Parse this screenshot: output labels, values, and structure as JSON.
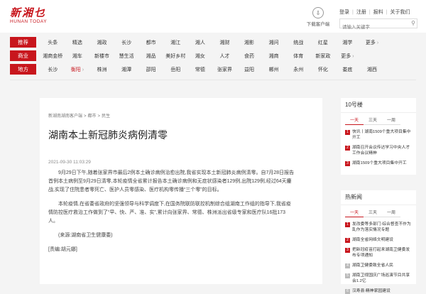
{
  "header": {
    "logo_cn": "新湘乜",
    "logo_en": "HUNAN TODAY",
    "app_label": "下载客户端",
    "links": [
      "登录",
      "注册",
      "报料",
      "关于我们"
    ],
    "search_placeholder": "请输入关键字"
  },
  "nav": [
    {
      "head": "推荐",
      "items": [
        "头条",
        "精选",
        "湘政",
        "长沙",
        "都市",
        "湘江",
        "湘人",
        "湘财",
        "湘影",
        "湘问",
        "统战",
        "红星",
        "湘学",
        "更多"
      ]
    },
    {
      "head": "商业",
      "items": [
        "湘商金桥",
        "湘车",
        "新楼市",
        "慧生活",
        "湘品",
        "美好乡村",
        "湘女",
        "人才",
        "食药",
        "湘商",
        "体育",
        "新家政",
        "更多"
      ]
    },
    {
      "head": "地方",
      "items": [
        "长沙",
        "衡阳",
        "株洲",
        "湘潭",
        "邵阳",
        "岳阳",
        "常德",
        "张家界",
        "益阳",
        "郴州",
        "永州",
        "怀化",
        "娄底",
        "湘西"
      ]
    }
  ],
  "article": {
    "breadcrumb": [
      "新湖南湖南客户端",
      "都市",
      "民生"
    ],
    "title": "湖南本土新冠肺炎病例清零",
    "date": "2021-09-30 11:03:29",
    "paragraphs": [
      "9月29日下午,随着张家界市最后2例本土确诊病例治愈出院,我省实现本土新冠肺炎病例清零。自7月28日报告首例本土病例至9月29日清零,本轮疫情全省累计报告本土确诊病例和无症状感染者129例,出院129例,经过64天鏖战,实现了住院患者零死亡、医护人员零感染、医疗机构零传播“三个零”的目标。",
      "本轮疫情,在省委省政府的坚强领导与科学调度下,在国务院联防联控机制综合组湖南工作组的指导下,我省疫情防控医疗救治工作做到了“早、快、严、准、实”,累计向张家界、常德、株洲派出省级专家和医疗队16批173人。",
      "(来源:湖南省卫生健康委)",
      "[责编:胡元娜]"
    ]
  },
  "sidebar1": {
    "title": "10号楼",
    "tabs": [
      "一天",
      "三天",
      "一周"
    ],
    "items": [
      "快讯丨湖南1509个重大项目集中开工",
      "湖南召开会议传达学习中央人才工作会议精神",
      "湖南1509个重大项目集中开工"
    ]
  },
  "sidebar2": {
    "title": "热新闻",
    "tabs": [
      "一天",
      "三天",
      "一周"
    ],
    "items": [
      "发改委等多部门:综合督查不作为乱作为落实情况专题",
      "湖南全省网络文明建设",
      "把新冠疫苗打起来湖南卫健委发布专项通知",
      "湖南卫健委致全省人民",
      "湖南卫视国庆广场巡演节目共享会1.2亿",
      "汉寿县:精神家园建设"
    ]
  }
}
